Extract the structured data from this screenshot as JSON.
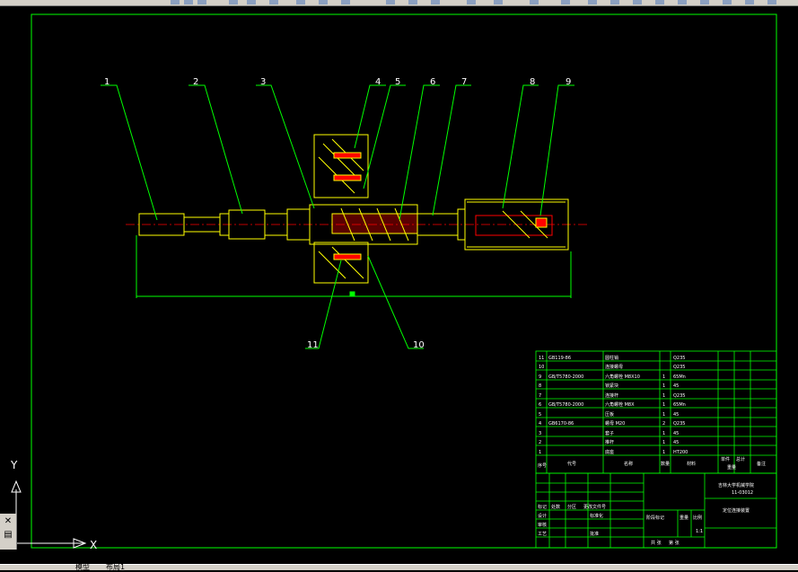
{
  "app": {
    "colors": {
      "background": "#000000",
      "frame": "#00ff00",
      "leader": "#00ff00",
      "part": "#ffff00",
      "centerline": "#ff0000",
      "text": "#ffffff",
      "label": "#ffffff"
    }
  },
  "drawing": {
    "balloons": [
      "1",
      "2",
      "3",
      "4",
      "5",
      "6",
      "7",
      "8",
      "9",
      "10",
      "11"
    ]
  },
  "bom": {
    "rows": [
      {
        "no": "11",
        "std": "GB119-86",
        "name": "圆柱销",
        "qty": "",
        "mat": "Q235"
      },
      {
        "no": "10",
        "std": "",
        "name": "连接螺母",
        "qty": "",
        "mat": "Q235"
      },
      {
        "no": "9",
        "std": "GB/T5780-2000",
        "name": "六角螺栓 M8X10",
        "qty": "1",
        "mat": "65Mn"
      },
      {
        "no": "8",
        "std": "",
        "name": "锁紧块",
        "qty": "1",
        "mat": "45"
      },
      {
        "no": "7",
        "std": "",
        "name": "连接杆",
        "qty": "1",
        "mat": "Q235"
      },
      {
        "no": "6",
        "std": "GB/T5780-2000",
        "name": "六角螺栓 M8X",
        "qty": "1",
        "mat": "65Mn"
      },
      {
        "no": "5",
        "std": "",
        "name": "压板",
        "qty": "1",
        "mat": "45"
      },
      {
        "no": "4",
        "std": "GB6170-86",
        "name": "螺母 M20",
        "qty": "2",
        "mat": "Q235"
      },
      {
        "no": "3",
        "std": "",
        "name": "套子",
        "qty": "1",
        "mat": "45"
      },
      {
        "no": "2",
        "std": "",
        "name": "推杆",
        "qty": "1",
        "mat": "45"
      },
      {
        "no": "1",
        "std": "",
        "name": "底座",
        "qty": "1",
        "mat": "HT200"
      }
    ],
    "header": {
      "no": "序号",
      "std": "代号",
      "name": "名称",
      "qty": "数量",
      "mat": "材料",
      "mass_single": "单件",
      "mass_total": "总计",
      "mass": "重量",
      "note": "备注"
    }
  },
  "title_block": {
    "school": "吉林大学机械学院",
    "code": "11-03012",
    "drawing_name": "定位连接装置",
    "row_labels": [
      "标记",
      "处数",
      "分区",
      "更改文件号",
      "设计",
      "标准化",
      "审核",
      "工艺",
      "批准"
    ],
    "cols": [
      "阶段标记",
      "重量",
      "比例"
    ],
    "scale": "1:1",
    "sheets": "共 张",
    "sheet_no": "第 张"
  },
  "ucs": {
    "y_label": "Y",
    "x_label": "X"
  },
  "tabs": [
    "模型",
    "布局1"
  ]
}
